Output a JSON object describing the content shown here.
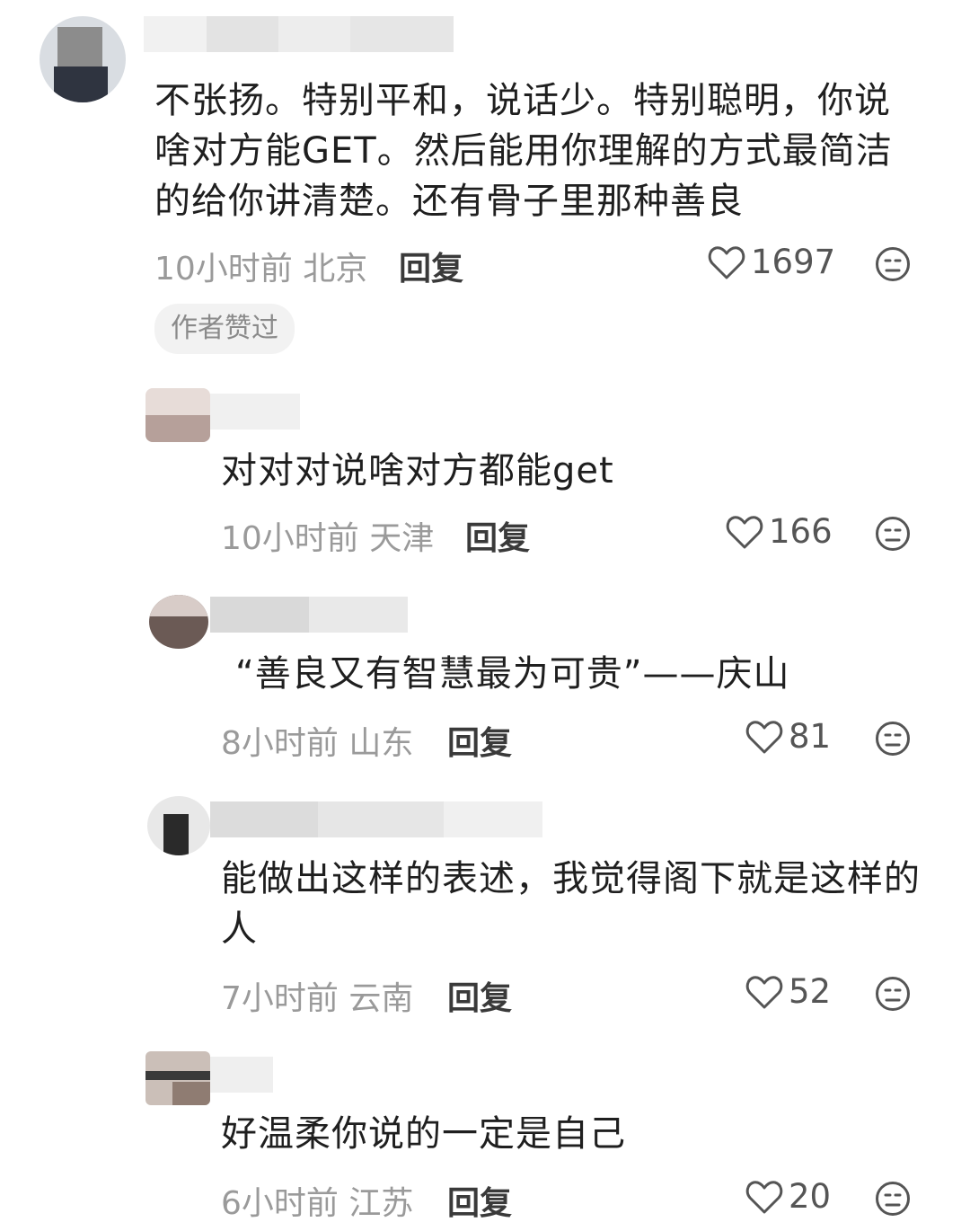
{
  "comments": [
    {
      "text": "不张扬。特别平和，说话少。特别聪明，你说啥对方能GET。然后能用你理解的方式最简洁的给你讲清楚。还有骨子里那种善良",
      "time": "10小时前",
      "location": "北京",
      "reply_label": "回复",
      "likes": "1697",
      "badge": "作者赞过"
    },
    {
      "text": "对对对说啥对方都能get",
      "time": "10小时前",
      "location": "天津",
      "reply_label": "回复",
      "likes": "166"
    },
    {
      "text": "“善良又有智慧最为可贵”——庆山",
      "time": "8小时前",
      "location": "山东",
      "reply_label": "回复",
      "likes": "81"
    },
    {
      "text": "能做出这样的表述，我觉得阁下就是这样的人",
      "time": "7小时前",
      "location": "云南",
      "reply_label": "回复",
      "likes": "52"
    },
    {
      "text": "好温柔你说的一定是自己",
      "time": "6小时前",
      "location": "江苏",
      "reply_label": "回复",
      "likes": "20"
    }
  ],
  "icons": {
    "like": "heart-outline-icon",
    "dislike": "meh-face-icon"
  },
  "colors": {
    "meta": "#9a9a9a",
    "text": "#1f1f1f",
    "badge_bg": "#f2f2f2"
  }
}
